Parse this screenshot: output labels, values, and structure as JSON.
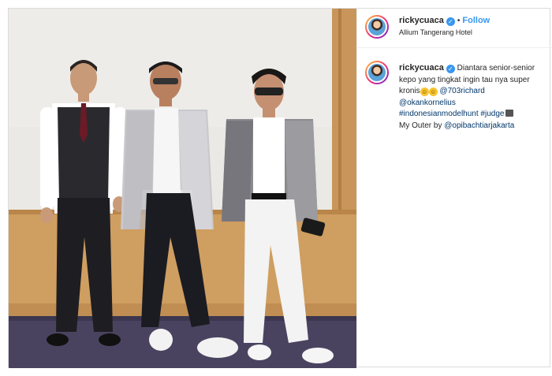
{
  "post": {
    "username": "rickycuaca",
    "follow_label": "Follow",
    "dot": "•",
    "location": "Allium Tangerang Hotel",
    "verified_icon": "verified-badge-icon",
    "caption": {
      "line1": "Diantara senior-senior",
      "line2": "kepo yang tingkat ingin tau nya super",
      "line3_text": "kronis",
      "line3_emoji": "grinning-sweat-emoji, rolling-laughing-emoji",
      "mention_1": "@703richard",
      "mention_2": "@okankornelius",
      "hashtag_1": "#indonesianmodelhunt",
      "hashtag_2": "#judge",
      "judge_emoji": "clapper-board-emoji",
      "line6_text": "My Outer by",
      "mention_3": "@opibachtiarjakarta"
    }
  },
  "colors": {
    "link_blue": "#3897f0",
    "tag_navy": "#00376b",
    "text": "#262626",
    "border": "#dbdbdb"
  }
}
